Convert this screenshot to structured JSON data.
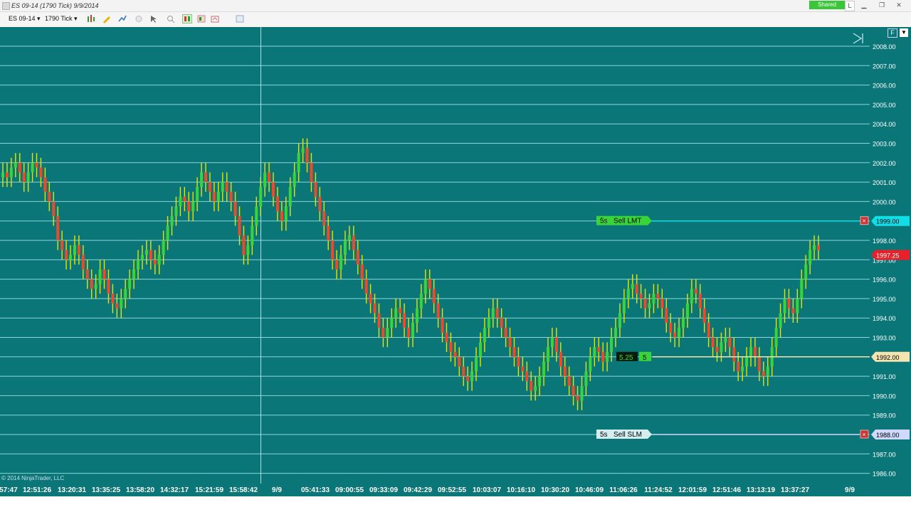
{
  "window": {
    "title": "ES 09-14 (1790 Tick)  9/9/2014",
    "shared_label": "Shared",
    "l_label": "L"
  },
  "toolbar": {
    "instrument": "ES 09-14 ▾",
    "interval": "1790 Tick ▾"
  },
  "chart": {
    "copyright": "© 2014 NinjaTrader, LLC",
    "price_levels": [
      2008,
      2007,
      2006,
      2005,
      2004,
      2003,
      2002,
      2001,
      2000,
      1999,
      1998,
      1997,
      1996,
      1995,
      1994,
      1993,
      1992,
      1991,
      1990,
      1989,
      1988,
      1987,
      1986
    ],
    "y_tick_labels": [
      "2008.00",
      "2007.00",
      "2006.00",
      "2005.00",
      "2004.00",
      "2003.00",
      "2002.00",
      "2001.00",
      "2000.00",
      "1999.00",
      "1998.00",
      "1997.00",
      "1996.00",
      "1995.00",
      "1994.00",
      "1993.00",
      "1992.00",
      "1991.00",
      "1990.00",
      "1989.00",
      "1988.00",
      "1987.00",
      "1986.00"
    ],
    "x_tick_labels": [
      "57:47",
      "12:51:26",
      "13:20:31",
      "13:35:25",
      "13:58:20",
      "14:32:17",
      "15:21:59",
      "15:58:42",
      "9/9",
      "05:41:33",
      "09:00:55",
      "09:33:09",
      "09:42:29",
      "09:52:55",
      "10:03:07",
      "10:16:10",
      "10:30:20",
      "10:46:09",
      "11:06:26",
      "11:24:52",
      "12:01:59",
      "12:51:46",
      "13:13:19",
      "13:37:27",
      "9/9"
    ],
    "up_color": "#39d43a",
    "down_color": "#ee4a2a",
    "wick_color": "#e6e600",
    "background": "#0b7678",
    "close_series": [
      2001.5,
      2001.25,
      2001.75,
      2002.0,
      2001.5,
      2001.0,
      2001.5,
      2002.0,
      2001.75,
      2001.25,
      2000.5,
      2000.0,
      1999.25,
      1998.0,
      1997.5,
      1997.0,
      1997.25,
      1997.75,
      1997.25,
      1996.5,
      1996.0,
      1995.5,
      1995.75,
      1996.5,
      1996.0,
      1995.25,
      1994.75,
      1994.5,
      1995.0,
      1995.5,
      1996.0,
      1996.5,
      1997.0,
      1997.25,
      1997.5,
      1997.0,
      1996.75,
      1997.25,
      1998.0,
      1998.75,
      1999.25,
      1999.75,
      2000.25,
      2000.0,
      1999.5,
      2000.0,
      2000.75,
      2001.5,
      2001.0,
      2000.5,
      2000.0,
      2000.5,
      2001.0,
      2000.5,
      2000.0,
      1999.25,
      1998.25,
      1997.25,
      1997.75,
      1998.75,
      1999.75,
      2000.75,
      2001.5,
      2001.0,
      2000.25,
      1999.5,
      1999.0,
      1999.75,
      2000.75,
      2001.5,
      2002.5,
      2002.75,
      2002.0,
      2001.0,
      2000.25,
      1999.5,
      1998.75,
      1998.0,
      1997.0,
      1996.5,
      1997.25,
      1998.0,
      1998.25,
      1997.5,
      1996.75,
      1996.0,
      1995.25,
      1994.75,
      1994.25,
      1993.5,
      1993.0,
      1993.5,
      1994.0,
      1994.5,
      1994.25,
      1993.5,
      1993.0,
      1993.75,
      1994.5,
      1995.25,
      1996.0,
      1995.5,
      1994.75,
      1994.0,
      1993.25,
      1992.75,
      1992.25,
      1992.0,
      1991.5,
      1991.0,
      1990.75,
      1991.25,
      1992.0,
      1992.75,
      1993.5,
      1994.0,
      1994.5,
      1994.0,
      1993.5,
      1993.0,
      1992.5,
      1992.0,
      1991.5,
      1991.25,
      1990.75,
      1990.25,
      1990.5,
      1991.0,
      1991.75,
      1992.5,
      1993.0,
      1992.25,
      1991.5,
      1991.0,
      1990.5,
      1990.0,
      1989.75,
      1990.5,
      1991.25,
      1992.0,
      1992.5,
      1992.25,
      1991.75,
      1992.25,
      1993.0,
      1993.5,
      1994.25,
      1995.0,
      1995.5,
      1995.75,
      1995.25,
      1995.0,
      1994.5,
      1994.75,
      1995.25,
      1995.0,
      1994.5,
      1993.75,
      1993.25,
      1993.0,
      1993.5,
      1994.0,
      1994.75,
      1995.5,
      1995.25,
      1994.5,
      1993.75,
      1993.0,
      1992.5,
      1992.25,
      1992.75,
      1993.0,
      1992.5,
      1991.75,
      1991.25,
      1991.5,
      1992.0,
      1992.5,
      1992.0,
      1991.25,
      1991.0,
      1991.5,
      1992.5,
      1993.5,
      1994.25,
      1995.0,
      1994.5,
      1994.25,
      1995.0,
      1996.0,
      1996.75,
      1997.5,
      1997.75,
      1997.5
    ],
    "current_price": {
      "label": "1997.25",
      "color": "#e8202a"
    },
    "orders": [
      {
        "tag": "5s",
        "label": "Sell LMT",
        "price": 1999.0,
        "price_label": "1999.00",
        "color": "#12dde6",
        "tag_bg": "#39d43a"
      },
      {
        "tag": "5s",
        "label": "Sell SLM",
        "price": 1988.0,
        "price_label": "1988.00",
        "color": "#cfd8ff",
        "tag_bg": "#d4eef0"
      }
    ],
    "position": {
      "avg_label": "5.25",
      "qty": "5",
      "price": 1992.0,
      "price_label": "1992.00",
      "color": "#f5e3b0"
    }
  }
}
